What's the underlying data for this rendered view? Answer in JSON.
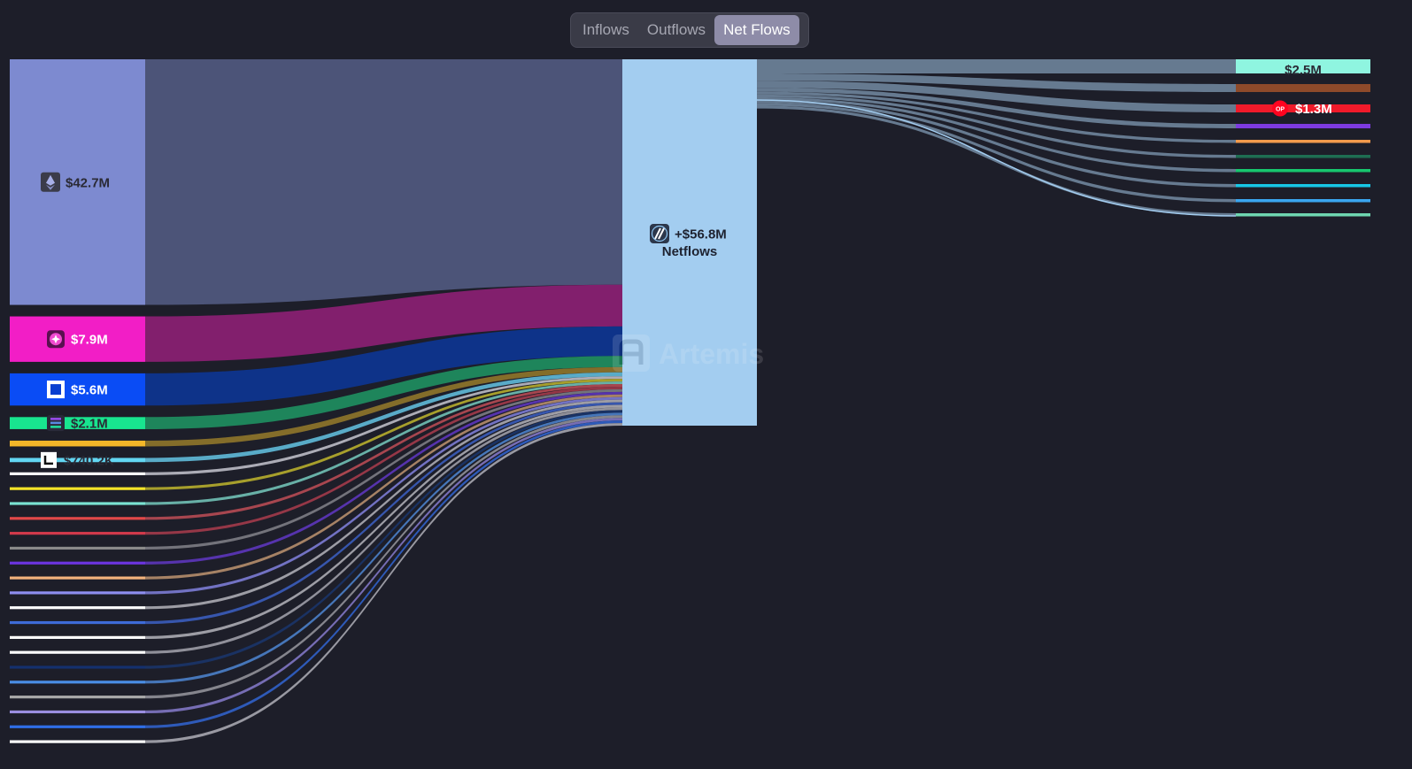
{
  "toggle": {
    "tabs": [
      {
        "label": "Inflows",
        "active": false
      },
      {
        "label": "Outflows",
        "active": false
      },
      {
        "label": "Net Flows",
        "active": true
      }
    ]
  },
  "watermark": "Artemis",
  "chart_data": {
    "type": "sankey",
    "target": {
      "label": "+$56.8M",
      "sublabel": "Netflows",
      "color": "#a3cdf0",
      "icon": "arbitrum-logo-icon"
    },
    "sources": [
      {
        "label": "$42.7M",
        "value": 42.7,
        "color": "#7d8ad0",
        "link_color": "#4c5478",
        "icon": "ethereum-logo-icon"
      },
      {
        "label": "$7.9M",
        "value": 7.9,
        "color": "#f21ec6",
        "link_color": "#8b1f73",
        "icon": "star-badge-icon"
      },
      {
        "label": "$5.6M",
        "value": 5.6,
        "color": "#0a4cf5",
        "link_color": "#0d3591",
        "icon": "square-logo-icon"
      },
      {
        "label": "$2.1M",
        "value": 2.1,
        "color": "#18e58f",
        "link_color": "#1e8e60",
        "icon": "solana-logo-icon"
      },
      {
        "label": "",
        "value": 1.0,
        "color": "#f4b729",
        "link_color": "#8d742a",
        "icon": ""
      },
      {
        "label": "$740.2K",
        "value": 0.74,
        "color": "#62d6f2",
        "link_color": "#5eb7d6",
        "icon": "linea-logo-icon"
      },
      {
        "label": "",
        "value": 0.35,
        "color": "#ffffff",
        "link_color": "#b8b9c2",
        "icon": ""
      },
      {
        "label": "",
        "value": 0.35,
        "color": "#f4e428",
        "link_color": "#b3aa2c",
        "icon": ""
      },
      {
        "label": "",
        "value": 0.35,
        "color": "#7ae3d2",
        "link_color": "#6fbdb2",
        "icon": ""
      },
      {
        "label": "",
        "value": 0.35,
        "color": "#e24848",
        "link_color": "#b34a52",
        "icon": ""
      },
      {
        "label": "",
        "value": 0.35,
        "color": "#d13a4b",
        "link_color": "#a03a4a",
        "icon": ""
      },
      {
        "label": "",
        "value": 0.35,
        "color": "#8a8a8a",
        "link_color": "#7b7b82",
        "icon": ""
      },
      {
        "label": "",
        "value": 0.35,
        "color": "#6b34e0",
        "link_color": "#5b35b8",
        "icon": ""
      },
      {
        "label": "",
        "value": 0.35,
        "color": "#f2b27c",
        "link_color": "#b28b6a",
        "icon": ""
      },
      {
        "label": "",
        "value": 0.35,
        "color": "#8e8ef0",
        "link_color": "#7a7ad0",
        "icon": ""
      },
      {
        "label": "",
        "value": 0.35,
        "color": "#ffffff",
        "link_color": "#a8a8b0",
        "icon": ""
      },
      {
        "label": "",
        "value": 0.35,
        "color": "#3e6bd8",
        "link_color": "#3a5bb8",
        "icon": ""
      },
      {
        "label": "",
        "value": 0.35,
        "color": "#ffffff",
        "link_color": "#a8a8b0",
        "icon": ""
      },
      {
        "label": "",
        "value": 0.35,
        "color": "#ffffff",
        "link_color": "#9a9aa4",
        "icon": ""
      },
      {
        "label": "",
        "value": 0.35,
        "color": "#14306e",
        "link_color": "#1a3468",
        "icon": ""
      },
      {
        "label": "",
        "value": 0.35,
        "color": "#4a8ee6",
        "link_color": "#4a7ec6",
        "icon": ""
      },
      {
        "label": "",
        "value": 0.35,
        "color": "#a8a8a8",
        "link_color": "#8e8e96",
        "icon": ""
      },
      {
        "label": "",
        "value": 0.35,
        "color": "#9a8ee0",
        "link_color": "#7e74c0",
        "icon": ""
      },
      {
        "label": "",
        "value": 0.35,
        "color": "#2f6ee6",
        "link_color": "#3060c6",
        "icon": ""
      },
      {
        "label": "",
        "value": 0.35,
        "color": "#ffffff",
        "link_color": "#a4a4ac",
        "icon": ""
      }
    ],
    "outputs": [
      {
        "label": "$2.5M",
        "value": 2.5,
        "color": "#8ff5e0",
        "icon": ""
      },
      {
        "label": "",
        "value": 1.4,
        "color": "#8e4a2a",
        "icon": ""
      },
      {
        "label": "$1.3M",
        "value": 1.3,
        "color": "#f01a2a",
        "icon": "optimism-logo-icon"
      },
      {
        "label": "",
        "value": 0.8,
        "color": "#7d3ae0",
        "icon": ""
      },
      {
        "label": "",
        "value": 0.5,
        "color": "#f29a4c",
        "icon": ""
      },
      {
        "label": "",
        "value": 0.5,
        "color": "#1e6e52",
        "icon": ""
      },
      {
        "label": "",
        "value": 0.5,
        "color": "#17c76e",
        "icon": ""
      },
      {
        "label": "",
        "value": 0.5,
        "color": "#17c7e6",
        "icon": ""
      },
      {
        "label": "",
        "value": 0.5,
        "color": "#3aa6f0",
        "icon": ""
      },
      {
        "label": "",
        "value": 0.5,
        "color": "#6ed6b0",
        "icon": ""
      }
    ],
    "output_link_color": "#6a7f96"
  }
}
